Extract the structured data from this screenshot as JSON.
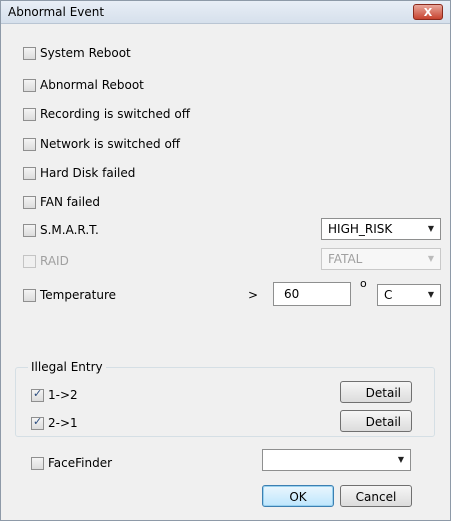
{
  "window": {
    "title": "Abnormal Event",
    "close_label": "X"
  },
  "events": {
    "system_reboot": "System Reboot",
    "abnormal_reboot": "Abnormal Reboot",
    "recording_off": "Recording is switched off",
    "network_off": "Network is switched off",
    "hdd_failed": "Hard Disk failed",
    "fan_failed": "FAN failed",
    "smart": {
      "label": "S.M.A.R.T.",
      "select_value": "HIGH_RISK"
    },
    "raid": {
      "label": "RAID",
      "select_value": "FATAL",
      "disabled": true
    },
    "temperature": {
      "label": "Temperature",
      "operator": ">",
      "value": "60",
      "degree": "o",
      "unit": "C"
    }
  },
  "illegal_entry": {
    "legend": "Illegal Entry",
    "rows": [
      {
        "label": "1->2",
        "checked": true,
        "button": "Detail"
      },
      {
        "label": "2->1",
        "checked": true,
        "button": "Detail"
      }
    ]
  },
  "facefinder": {
    "label": "FaceFinder",
    "select_value": ""
  },
  "buttons": {
    "ok": "OK",
    "cancel": "Cancel"
  }
}
